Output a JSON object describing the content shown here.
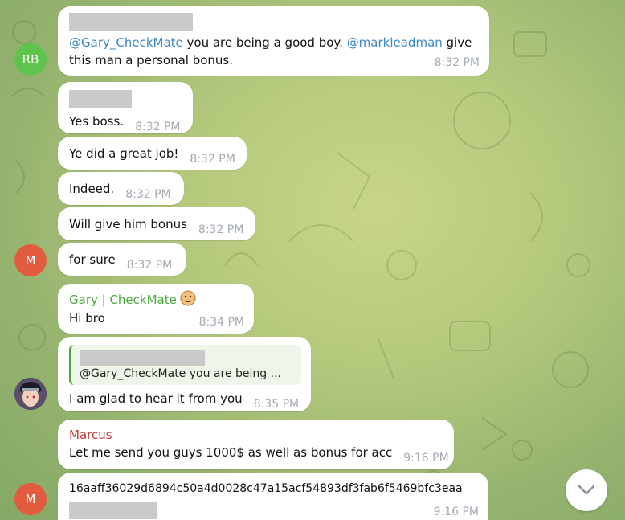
{
  "messages": [
    {
      "avatar_initials": "RB",
      "mention1": "@Gary_CheckMate",
      "text_part1": " you are being a good boy. ",
      "mention2": "@markleadman",
      "text_part2": " give this man a personal bonus.",
      "time": "8:32 PM"
    },
    {
      "text": "Yes boss.",
      "time": "8:32 PM"
    },
    {
      "text": "Ye did a great job!",
      "time": "8:32 PM"
    },
    {
      "text": "Indeed.",
      "time": "8:32 PM"
    },
    {
      "text": "Will give him bonus",
      "time": "8:32 PM"
    },
    {
      "avatar_initials": "M",
      "text": "for sure",
      "time": "8:32 PM"
    },
    {
      "sender": "Gary | CheckMate",
      "text": "Hi bro",
      "time": "8:34 PM"
    },
    {
      "reply_quote": "@Gary_CheckMate you are being ...",
      "text": "I am glad to hear it from you",
      "time": "8:35 PM"
    },
    {
      "sender": "Marcus",
      "text": "Let me send you guys 1000$ as well as bonus for acc",
      "time": "9:16 PM"
    },
    {
      "avatar_initials": "M",
      "text": "16aaff36029d6894c50a4d0028c47a15acf54893df3fab6f5469bfc3eaa",
      "time": "9:16 PM"
    }
  ],
  "colors": {
    "rb_avatar": "#5fc44f",
    "m_avatar": "#e35b3f",
    "mention": "#3d87c5",
    "gary_sender": "#4aa83c",
    "marcus_sender": "#c33c3c"
  },
  "icons": {
    "scroll_down": "chevron-down-icon",
    "sender_emoji": "face-emoji-icon"
  }
}
